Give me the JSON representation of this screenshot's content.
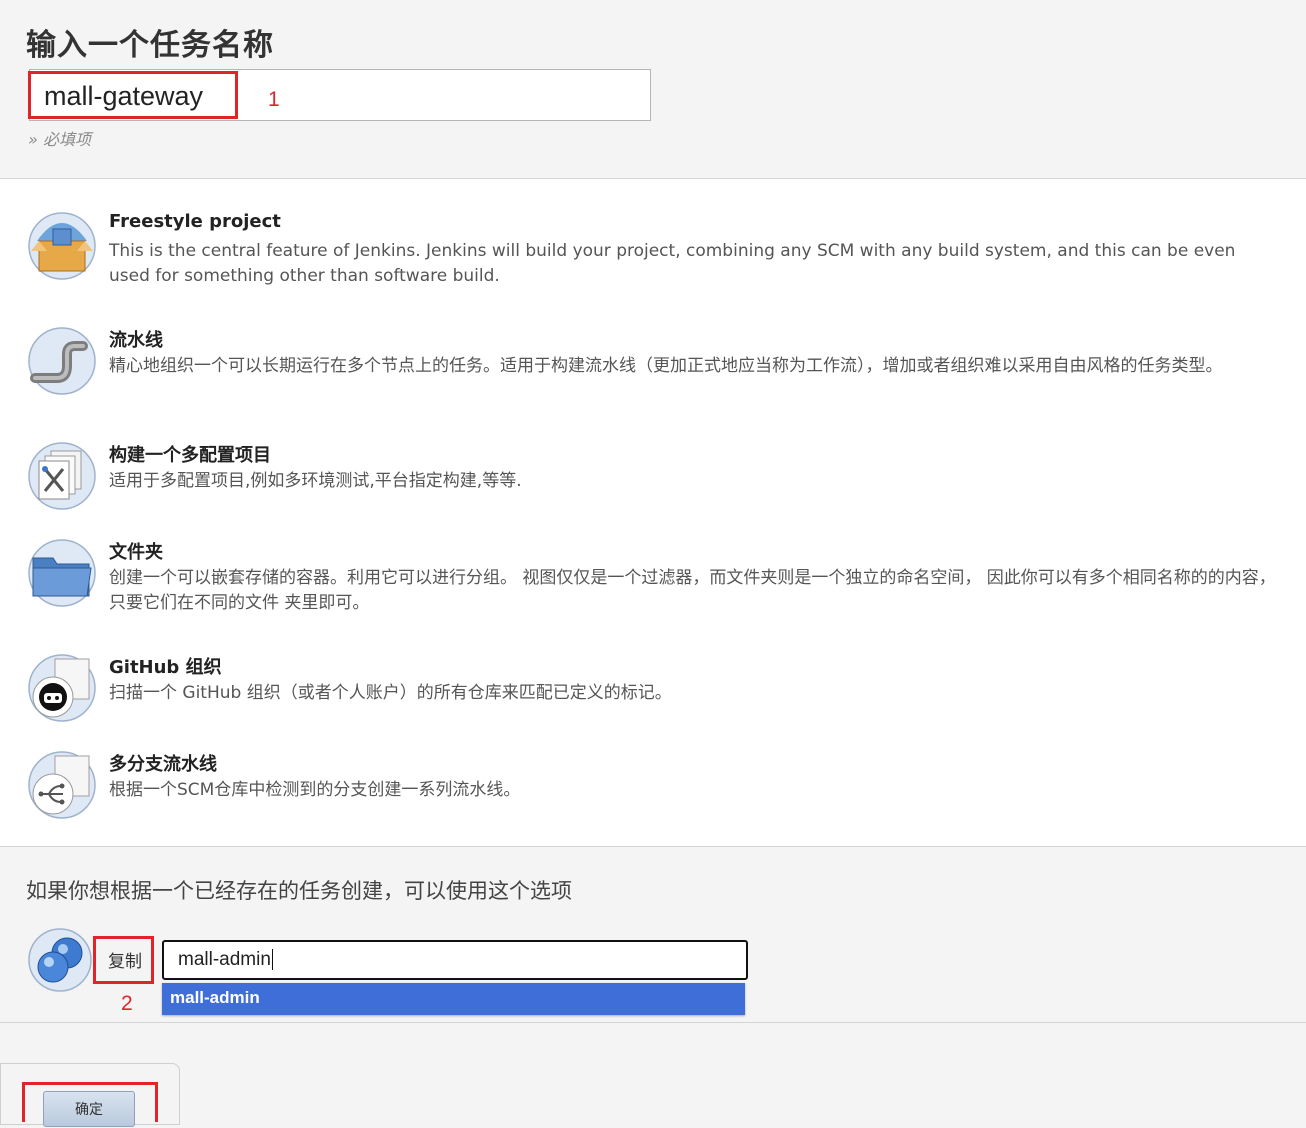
{
  "header": {
    "title": "输入一个任务名称",
    "name_value": "mall-gateway",
    "annotation_1": "1",
    "required_note": "» 必填项"
  },
  "items": [
    {
      "title": "Freestyle project",
      "desc": "This is the central feature of Jenkins. Jenkins will build your project, combining any SCM with any build system, and this can be even used for something other than software build.",
      "icon": "freestyle-project-icon"
    },
    {
      "title": "流水线",
      "desc": "精心地组织一个可以长期运行在多个节点上的任务。适用于构建流水线（更加正式地应当称为工作流），增加或者组织难以采用自由风格的任务类型。",
      "icon": "pipeline-icon"
    },
    {
      "title": "构建一个多配置项目",
      "desc": "适用于多配置项目,例如多环境测试,平台指定构建,等等.",
      "icon": "multi-configuration-icon"
    },
    {
      "title": "文件夹",
      "desc": "创建一个可以嵌套存储的容器。利用它可以进行分组。 视图仅仅是一个过滤器，而文件夹则是一个独立的命名空间， 因此你可以有多个相同名称的的内容，只要它们在不同的文件 夹里即可。",
      "icon": "folder-icon"
    },
    {
      "title": "GitHub 组织",
      "desc": "扫描一个 GitHub 组织（或者个人账户）的所有仓库来匹配已定义的标记。",
      "icon": "github-organization-icon"
    },
    {
      "title": "多分支流水线",
      "desc": "根据一个SCM仓库中检测到的分支创建一系列流水线。",
      "icon": "multibranch-pipeline-icon"
    }
  ],
  "copy": {
    "heading": "如果你想根据一个已经存在的任务创建，可以使用这个选项",
    "label": "复制",
    "input_value": "mall-admin",
    "suggestion": "mall-admin",
    "annotation_2": "2"
  },
  "footer": {
    "ok_label": "确定"
  },
  "colors": {
    "highlight_red": "#e0242a",
    "suggestion_blue": "#3f6ed8"
  }
}
